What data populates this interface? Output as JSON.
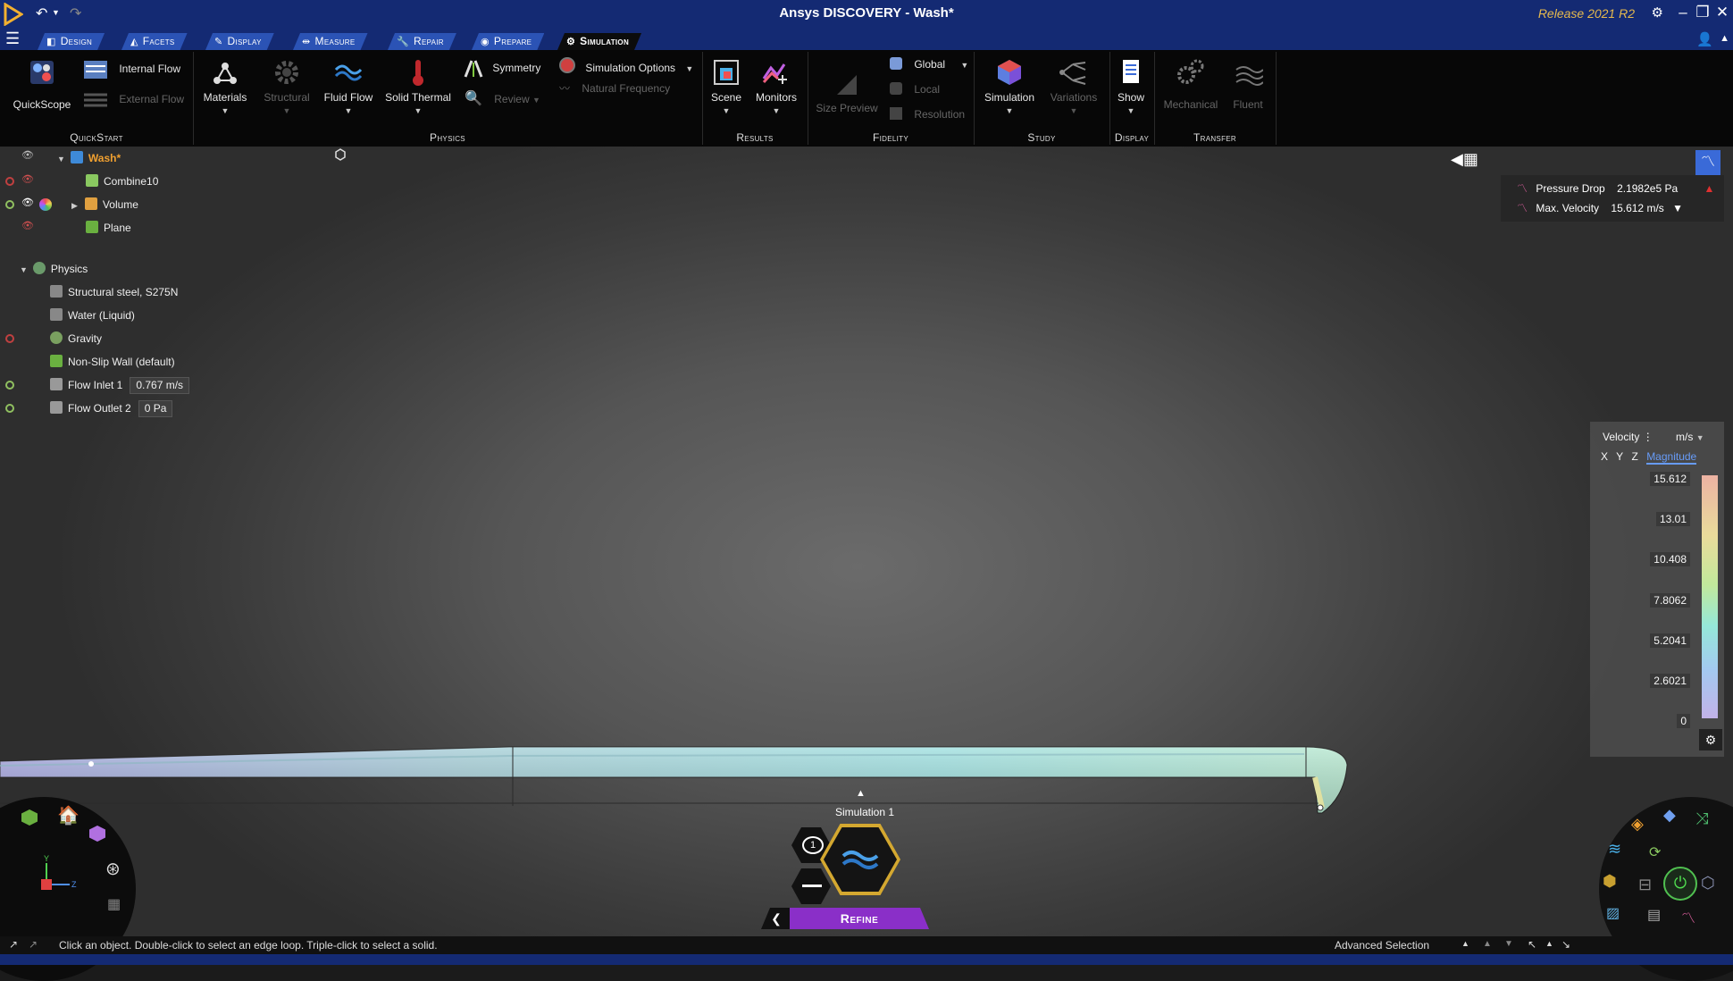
{
  "app": {
    "title": "Ansys DISCOVERY - Wash*",
    "release": "Release 2021 R2"
  },
  "tabs": [
    {
      "label": "Design"
    },
    {
      "label": "Facets"
    },
    {
      "label": "Display"
    },
    {
      "label": "Measure"
    },
    {
      "label": "Repair"
    },
    {
      "label": "Prepare"
    },
    {
      "label": "Simulation"
    }
  ],
  "ribbon": {
    "quickstart": {
      "label": "QuickStart",
      "quickscope": "QuickScope",
      "internal_flow": "Internal Flow",
      "external_flow": "External Flow"
    },
    "physics": {
      "label": "Physics",
      "materials": "Materials",
      "structural": "Structural",
      "fluid_flow": "Fluid Flow",
      "solid_thermal": "Solid Thermal",
      "symmetry": "Symmetry",
      "review": "Review",
      "simulation_options": "Simulation Options",
      "natural_frequency": "Natural Frequency"
    },
    "results": {
      "label": "Results",
      "scene": "Scene",
      "monitors": "Monitors"
    },
    "fidelity": {
      "label": "Fidelity",
      "size_preview": "Size Preview",
      "global": "Global",
      "local": "Local",
      "resolution": "Resolution"
    },
    "study": {
      "label": "Study",
      "simulation": "Simulation",
      "variations": "Variations"
    },
    "display": {
      "label": "Display",
      "show": "Show"
    },
    "transfer": {
      "label": "Transfer",
      "mechanical": "Mechanical",
      "fluent": "Fluent"
    }
  },
  "tree": {
    "root": "Wash*",
    "items": [
      "Combine10",
      "Volume",
      "Plane"
    ],
    "physics_label": "Physics",
    "physics_items": [
      {
        "label": "Structural steel, S275N",
        "value": ""
      },
      {
        "label": "Water (Liquid)",
        "value": ""
      },
      {
        "label": "Gravity",
        "value": ""
      },
      {
        "label": "Non-Slip Wall (default)",
        "value": ""
      },
      {
        "label": "Flow Inlet 1",
        "value": "0.767 m/s"
      },
      {
        "label": "Flow Outlet 2",
        "value": "0 Pa"
      }
    ]
  },
  "monitors": [
    {
      "label": "Pressure Drop",
      "value": "2.1982e5 Pa"
    },
    {
      "label": "Max. Velocity",
      "value": "15.612 m/s"
    }
  ],
  "legend": {
    "quantity": "Velocity",
    "unit": "m/s",
    "components": [
      "X",
      "Y",
      "Z",
      "Magnitude"
    ],
    "values": [
      "15.612",
      "13.01",
      "10.408",
      "7.8062",
      "5.2041",
      "2.6021",
      "0"
    ]
  },
  "simulation": {
    "name": "Simulation 1",
    "slot_number": "1",
    "refine_label": "Refine"
  },
  "status": {
    "hint": "Click an object. Double-click to select an edge loop. Triple-click to select a solid.",
    "advanced_selection": "Advanced Selection"
  },
  "colors": {
    "title_bar": "#142a73",
    "tab": "#2b53b5",
    "accent_orange": "#f0a030",
    "refine_purple": "#8a2fc8",
    "release_text": "#e6b94d"
  }
}
